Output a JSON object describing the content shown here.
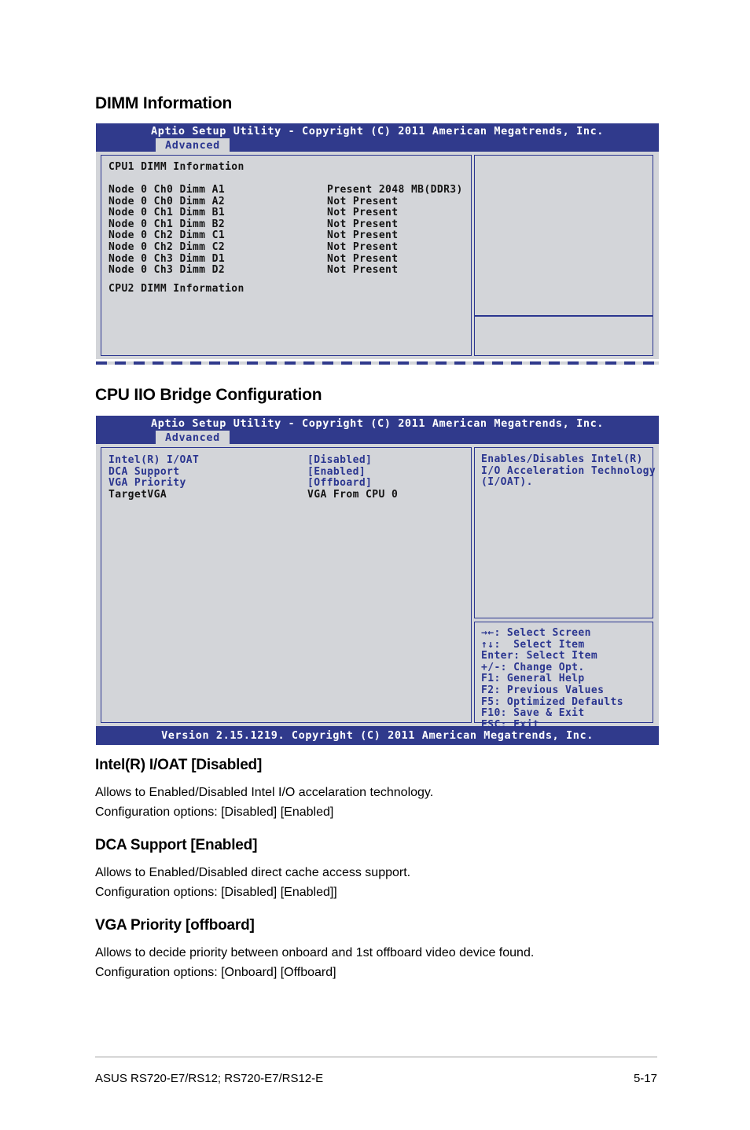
{
  "document": {
    "sections": [
      {
        "heading": "DIMM Information"
      },
      {
        "heading": "CPU IIO Bridge Configuration"
      }
    ],
    "descriptions": [
      {
        "heading": "Intel(R) I/OAT [Disabled]",
        "line1": "Allows to Enabled/Disabled Intel I/O accelaration technology.",
        "line2": "Configuration options: [Disabled] [Enabled]"
      },
      {
        "heading": "DCA Support [Enabled]",
        "line1": "Allows to Enabled/Disabled direct cache access support.",
        "line2": "Configuration options: [Disabled] [Enabled]]"
      },
      {
        "heading": "VGA Priority [offboard]",
        "line1": "Allows to decide priority between onboard and 1st offboard video device found.",
        "line2": "Configuration options: [Onboard] [Offboard]"
      }
    ]
  },
  "footer": {
    "product": "ASUS RS720-E7/RS12; RS720-E7/RS12-E",
    "page": "5-17"
  },
  "bios_common": {
    "title": "Aptio Setup Utility - Copyright (C) 2011 American Megatrends, Inc.",
    "tab": "Advanced",
    "version": "Version 2.15.1219. Copyright (C) 2011 American Megatrends, Inc."
  },
  "screen1": {
    "cpu1_label": "CPU1 DIMM Information",
    "cpu2_label": "CPU2 DIMM Information",
    "dimm_rows": [
      {
        "slot": "Node 0 Ch0 Dimm A1",
        "status": "Present 2048 MB(DDR3)"
      },
      {
        "slot": "Node 0 Ch0 Dimm A2",
        "status": "Not Present"
      },
      {
        "slot": "Node 0 Ch1 Dimm B1",
        "status": "Not Present"
      },
      {
        "slot": "Node 0 Ch1 Dimm B2",
        "status": "Not Present"
      },
      {
        "slot": "Node 0 Ch2 Dimm C1",
        "status": "Not Present"
      },
      {
        "slot": "Node 0 Ch2 Dimm C2",
        "status": "Not Present"
      },
      {
        "slot": "Node 0 Ch3 Dimm D1",
        "status": "Not Present"
      },
      {
        "slot": "Node 0 Ch3 Dimm D2",
        "status": "Not Present"
      }
    ]
  },
  "screen2": {
    "items": [
      {
        "label": "Intel(R) I/OAT",
        "value": "[Disabled]"
      },
      {
        "label": "DCA Support",
        "value": "[Enabled]"
      },
      {
        "label": "VGA Priority",
        "value": "[Offboard]"
      },
      {
        "label": "TargetVGA",
        "value": "VGA From CPU 0"
      }
    ],
    "help": [
      "Enables/Disables Intel(R)",
      "I/O Acceleration Technology",
      "(I/OAT)."
    ],
    "nav": [
      "→←: Select Screen",
      "↑↓:  Select Item",
      "Enter: Select Item",
      "+/-: Change Opt.",
      "F1: General Help",
      "F2: Previous Values",
      "F5: Optimized Defaults",
      "F10: Save & Exit",
      "ESC: Exit"
    ]
  },
  "colors": {
    "bios_blue": "#303a8c",
    "border_blue": "#2b3690",
    "panel_gray": "#d3d5d9"
  }
}
